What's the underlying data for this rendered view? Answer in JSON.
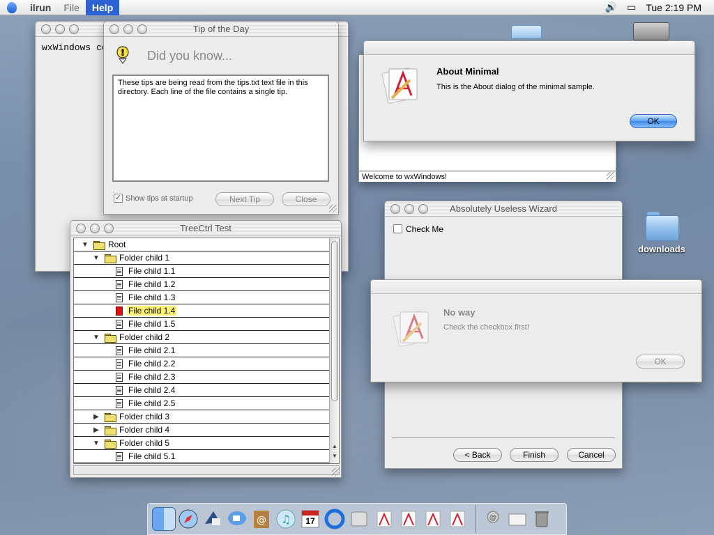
{
  "menubar": {
    "app_name": "ilrun",
    "menus": [
      "File",
      "Help"
    ],
    "active_menu": "Help",
    "clock": "Tue 2:19 PM",
    "volume_icon": "speaker-icon",
    "battery_icon": "battery-icon"
  },
  "minimal_window": {
    "text": "wxWindows co",
    "status": "Welcome to wxWindows!"
  },
  "tip_window": {
    "title": "Tip of the Day",
    "heading": "Did you know...",
    "tip_text": "These tips are being read from the tips.txt text file in this directory. Each line of the file contains a single tip.",
    "show_tips_label": "Show tips at startup",
    "show_tips_checked": true,
    "next_label": "Next Tip",
    "close_label": "Close"
  },
  "about_dialog": {
    "title": "About Minimal",
    "message": "This is the About dialog of the minimal sample.",
    "ok_label": "OK"
  },
  "tree_window": {
    "title": "TreeCtrl Test",
    "rows": [
      {
        "label": "Root",
        "type": "folder",
        "level": 0,
        "twisty": "open"
      },
      {
        "label": "Folder child 1",
        "type": "folder",
        "level": 1,
        "twisty": "open"
      },
      {
        "label": "File child 1.1",
        "type": "file",
        "level": 2
      },
      {
        "label": "File child 1.2",
        "type": "file",
        "level": 2
      },
      {
        "label": "File child 1.3",
        "type": "file",
        "level": 2
      },
      {
        "label": "File child 1.4",
        "type": "file-selected",
        "level": 2
      },
      {
        "label": "File child 1.5",
        "type": "file",
        "level": 2
      },
      {
        "label": "Folder child 2",
        "type": "folder",
        "level": 1,
        "twisty": "open"
      },
      {
        "label": "File child 2.1",
        "type": "file",
        "level": 2
      },
      {
        "label": "File child 2.2",
        "type": "file",
        "level": 2
      },
      {
        "label": "File child 2.3",
        "type": "file",
        "level": 2
      },
      {
        "label": "File child 2.4",
        "type": "file",
        "level": 2
      },
      {
        "label": "File child 2.5",
        "type": "file",
        "level": 2
      },
      {
        "label": "Folder child 3",
        "type": "folder",
        "level": 1,
        "twisty": "closed"
      },
      {
        "label": "Folder child 4",
        "type": "folder",
        "level": 1,
        "twisty": "closed"
      },
      {
        "label": "Folder child 5",
        "type": "folder",
        "level": 1,
        "twisty": "open"
      },
      {
        "label": "File child 5.1",
        "type": "file",
        "level": 2
      }
    ]
  },
  "wizard_window": {
    "title": "Absolutely Useless Wizard",
    "checkbox_label": "Check Me",
    "back_label": "< Back",
    "finish_label": "Finish",
    "cancel_label": "Cancel"
  },
  "noway_dialog": {
    "title": "No way",
    "message": "Check the checkbox first!",
    "ok_label": "OK"
  },
  "desktop": {
    "icons": [
      {
        "label": "downloads",
        "icon": "folder-icon"
      }
    ]
  },
  "dock": {
    "items": [
      "finder-icon",
      "safari-icon",
      "mail-bird-icon",
      "ichat-icon",
      "address-book-icon",
      "itunes-icon",
      "ical-icon",
      "quicktime-icon",
      "system-prefs-icon",
      "app-icon",
      "app-icon",
      "app-icon",
      "app-icon"
    ],
    "ical_day": "17",
    "right_items": [
      "network-icon",
      "document-icon",
      "trash-icon"
    ]
  }
}
